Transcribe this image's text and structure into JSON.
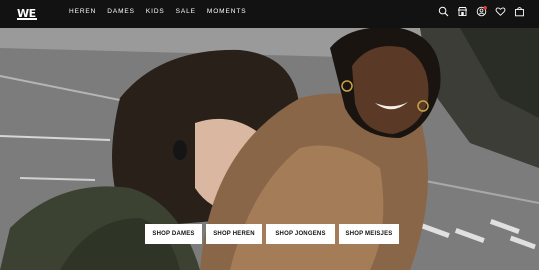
{
  "header": {
    "logo_text": "WE",
    "nav": [
      "HEREN",
      "DAMES",
      "KIDS",
      "SALE",
      "MOMENTS"
    ],
    "icons": [
      "search-icon",
      "store-icon",
      "account-icon",
      "heart-icon",
      "bag-icon"
    ],
    "account_badge_color": "#e53935"
  },
  "hero": {
    "buttons": [
      "SHOP DAMES",
      "SHOP HEREN",
      "SHOP JONGENS",
      "SHOP MEISJES"
    ]
  },
  "colors": {
    "header_bg": "#121212",
    "button_bg": "#ffffff",
    "button_text": "#111111"
  }
}
